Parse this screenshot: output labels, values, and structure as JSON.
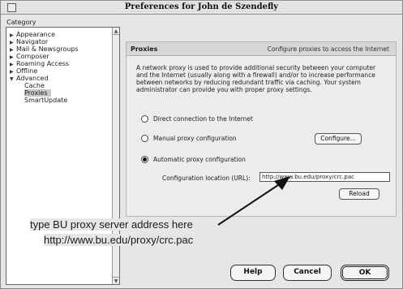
{
  "window": {
    "title": "Preferences for John de Szendefly"
  },
  "sidebar": {
    "category_label": "Category",
    "items": [
      {
        "label": "Appearance",
        "expanded": false,
        "level": 0
      },
      {
        "label": "Navigator",
        "expanded": false,
        "level": 0
      },
      {
        "label": "Mail & Newsgroups",
        "expanded": false,
        "level": 0
      },
      {
        "label": "Composer",
        "expanded": false,
        "level": 0
      },
      {
        "label": "Roaming Access",
        "expanded": false,
        "level": 0
      },
      {
        "label": "Offline",
        "expanded": false,
        "level": 0
      },
      {
        "label": "Advanced",
        "expanded": true,
        "level": 0
      },
      {
        "label": "Cache",
        "level": 1
      },
      {
        "label": "Proxies",
        "level": 1,
        "selected": true
      },
      {
        "label": "SmartUpdate",
        "level": 1
      }
    ]
  },
  "panel": {
    "title": "Proxies",
    "subtitle": "Configure proxies to access the Internet",
    "description": "A network proxy is used to provide additional security between your computer and the Internet (usually along with a firewall) and/or to increase performance between networks by reducing redundant traffic via caching. Your system administrator can provide you with proper proxy settings.",
    "options": [
      {
        "label": "Direct connection to the Internet",
        "checked": false
      },
      {
        "label": "Manual proxy configuration",
        "checked": false
      },
      {
        "label": "Automatic proxy configuration",
        "checked": true
      }
    ],
    "configure_button": "Configure...",
    "url_label": "Configuration location (URL):",
    "url_value": "http://www.bu.edu/proxy/crc.pac",
    "reload_button": "Reload"
  },
  "annotation": {
    "line1": "type BU proxy server address here",
    "line2": "http://www.bu.edu/proxy/crc.pac"
  },
  "footer": {
    "help": "Help",
    "cancel": "Cancel",
    "ok": "OK"
  },
  "colors": {
    "window_bg": "#e6e6e6",
    "panel_bg": "#ececec",
    "selected_bg": "#c8c8c8"
  }
}
